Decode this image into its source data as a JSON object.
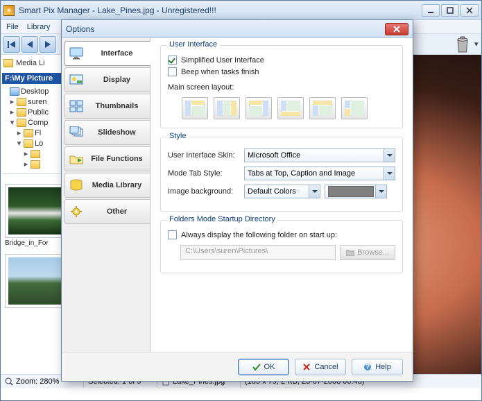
{
  "window": {
    "title": "Smart Pix Manager - Lake_Pines.jpg - Unregistered!!!"
  },
  "menu": {
    "file": "File",
    "library": "Library"
  },
  "sidebar": {
    "header": "Media Li",
    "drive": "F:\\My Picture",
    "tree": {
      "desktop": "Desktop",
      "suren": "suren",
      "public": "Public",
      "comp": "Comp",
      "fl": "Fl",
      "lo": "Lo"
    }
  },
  "thumbs": {
    "label1": "Bridge_in_For"
  },
  "status": {
    "zoom": "Zoom: 280%",
    "selected": "Selected: 1 of 9",
    "filename": "Lake_Pines.jpg",
    "info": "(105 x 79, 2 KB, 23-07-2008 00:43)"
  },
  "dialog": {
    "title": "Options",
    "tabs": {
      "interface": "Interface",
      "display": "Display",
      "thumbnails": "Thumbnails",
      "slideshow": "Slideshow",
      "file_functions": "File Functions",
      "media_library": "Media Library",
      "other": "Other"
    },
    "ui_group": {
      "title": "User Interface",
      "simplified": "Simplified User Interface",
      "beep": "Beep when tasks finish",
      "layout_label": "Main screen layout:"
    },
    "style_group": {
      "title": "Style",
      "skin_label": "User Interface Skin:",
      "skin_value": "Microsoft Office",
      "tabstyle_label": "Mode Tab Style:",
      "tabstyle_value": "Tabs at Top, Caption and Image",
      "bg_label": "Image background:",
      "bg_value": "Default Colors"
    },
    "startup_group": {
      "title": "Folders Mode Startup Directory",
      "always": "Always display the following folder on start up:",
      "path": "C:\\Users\\suren\\Pictures\\",
      "browse": "Browse..."
    },
    "buttons": {
      "ok": "OK",
      "cancel": "Cancel",
      "help": "Help"
    }
  }
}
